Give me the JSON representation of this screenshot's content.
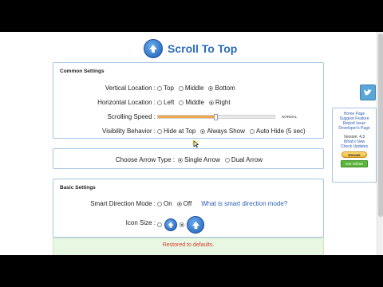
{
  "header": {
    "title": "Scroll To Top",
    "icon": "up-arrow-circle-icon"
  },
  "common_settings": {
    "title": "Common Settings",
    "vertical_location": {
      "label": "Vertical Location :",
      "options": [
        "Top",
        "Middle",
        "Bottom"
      ],
      "selected": "Bottom"
    },
    "horizontal_location": {
      "label": "Horizontal Location :",
      "options": [
        "Left",
        "Middle",
        "Right"
      ],
      "selected": "Right"
    },
    "scrolling_speed": {
      "label": "Scrolling Speed :",
      "value_label": "NORMAL",
      "level": 0.5
    },
    "visibility_behavior": {
      "label": "Visibility Behavior :",
      "options": [
        "Hide at Top",
        "Always Show",
        "Auto Hide (5 sec)"
      ],
      "selected": "Always Show"
    }
  },
  "arrow_type": {
    "label": "Choose Arrow Type :",
    "options": [
      "Single Arrow",
      "Dual Arrow"
    ],
    "selected": "Single Arrow"
  },
  "basic_settings": {
    "title": "Basic Settings",
    "smart_direction": {
      "label": "Smart Direction Mode :",
      "options": [
        "On",
        "Off"
      ],
      "selected": "Off",
      "help_link": "What is smart direction mode?"
    },
    "icon_size": {
      "label": "Icon Size :",
      "selected": "large"
    }
  },
  "notice": {
    "text": "Restored to defaults."
  },
  "sidebar": {
    "twitter_icon": "twitter-bird-icon",
    "links": [
      "Home Page",
      "Suggest Feature",
      "Report Issue",
      "Developer's Page"
    ],
    "version": "Version: 4.3",
    "whats_new": "What's New",
    "check_updates": "Check Updates",
    "donate_label": "Donate",
    "github_label": "Get Github"
  },
  "colors": {
    "accent": "#2b6cb8",
    "slider_fill": "#f0a64a",
    "notice_bg": "#e8f7e2",
    "notice_text": "#d63b2b",
    "github": "#5ab53b"
  }
}
